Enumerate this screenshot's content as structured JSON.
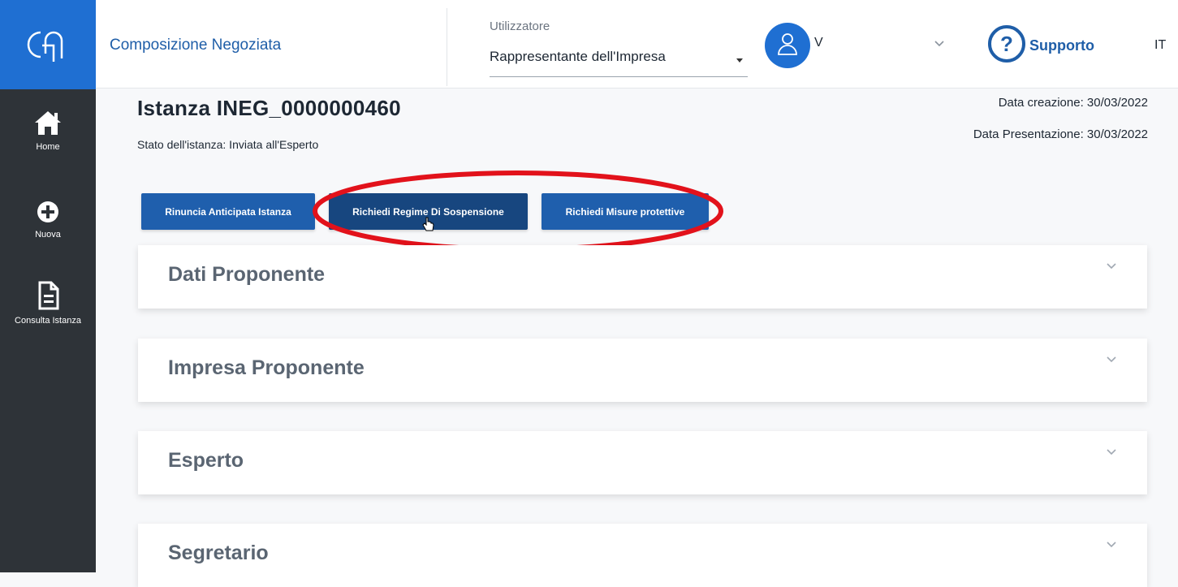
{
  "sidebar": {
    "logo": "CN logo",
    "items": [
      {
        "label": "Home",
        "icon": "home-icon"
      },
      {
        "label": "Nuova",
        "icon": "plus-circle-icon"
      },
      {
        "label": "Consulta Istanza",
        "icon": "document-icon"
      }
    ]
  },
  "header": {
    "app_title": "Composizione Negoziata",
    "user_label": "Utilizzatore",
    "user_role": "Rappresentante dell'Impresa",
    "user_name": "V",
    "support_label": "Supporto",
    "language": "IT"
  },
  "istanza": {
    "title": "Istanza INEG_0000000460",
    "status": "Stato dell'istanza: Inviata all'Esperto",
    "data_creazione": "Data creazione: 30/03/2022",
    "data_presentazione": "Data Presentazione: 30/03/2022"
  },
  "actions": {
    "rinuncia": "Rinuncia Anticipata Istanza",
    "sospensione": "Richiedi Regime Di Sospensione",
    "misure": "Richiedi Misure protettive"
  },
  "panels": [
    {
      "title": "Dati Proponente"
    },
    {
      "title": "Impresa Proponente"
    },
    {
      "title": "Esperto"
    },
    {
      "title": "Segretario"
    }
  ],
  "colors": {
    "brand_blue": "#1f6fd2",
    "button_blue": "#1f5fad",
    "sidebar_dark": "#2e3338",
    "highlight_red": "#e2121b"
  }
}
